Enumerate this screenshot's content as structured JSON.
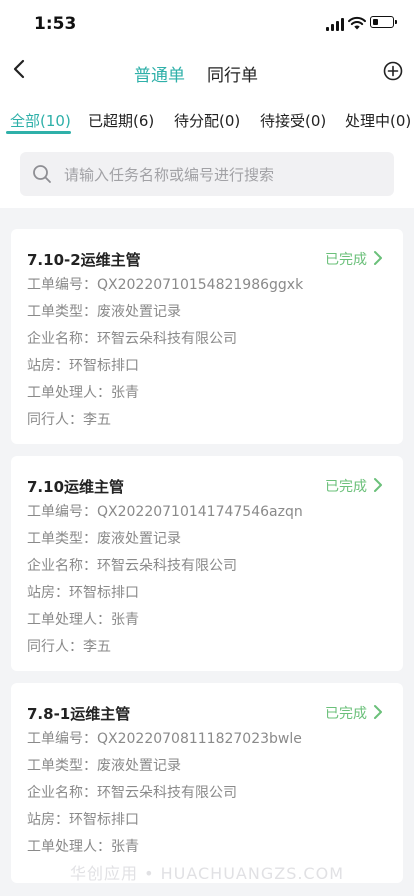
{
  "status_bar": {
    "time": "1:53"
  },
  "nav": {
    "segments": [
      "普通单",
      "同行单"
    ],
    "active": 0
  },
  "tabs": [
    {
      "label": "全部(10)",
      "active": true
    },
    {
      "label": "已超期(6)",
      "active": false
    },
    {
      "label": "待分配(0)",
      "active": false
    },
    {
      "label": "待接受(0)",
      "active": false
    },
    {
      "label": "处理中(0)",
      "active": false
    }
  ],
  "search": {
    "placeholder": "请输入任务名称或编号进行搜索",
    "value": ""
  },
  "cards": [
    {
      "title": "7.10-2运维主管",
      "status": "已完成",
      "rows": [
        {
          "label": "工单编号：",
          "value": "QX20220710154821986ggxk"
        },
        {
          "label": "工单类型：",
          "value": "废液处置记录"
        },
        {
          "label": "企业名称：",
          "value": "环智云朵科技有限公司"
        },
        {
          "label": "站房：",
          "value": "环智标排口"
        },
        {
          "label": "工单处理人：",
          "value": "张青"
        },
        {
          "label": "同行人：",
          "value": "李五"
        }
      ]
    },
    {
      "title": "7.10运维主管",
      "status": "已完成",
      "rows": [
        {
          "label": "工单编号：",
          "value": "QX20220710141747546azqn"
        },
        {
          "label": "工单类型：",
          "value": "废液处置记录"
        },
        {
          "label": "企业名称：",
          "value": "环智云朵科技有限公司"
        },
        {
          "label": "站房：",
          "value": "环智标排口"
        },
        {
          "label": "工单处理人：",
          "value": "张青"
        },
        {
          "label": "同行人：",
          "value": "李五"
        }
      ]
    },
    {
      "title": "7.8-1运维主管",
      "status": "已完成",
      "rows": [
        {
          "label": "工单编号：",
          "value": "QX20220708111827023bwle"
        },
        {
          "label": "工单类型：",
          "value": "废液处置记录"
        },
        {
          "label": "企业名称：",
          "value": "环智云朵科技有限公司"
        },
        {
          "label": "站房：",
          "value": "环智标排口"
        },
        {
          "label": "工单处理人：",
          "value": "张青"
        }
      ]
    }
  ],
  "watermark": "华创应用 • HUACHUANGZS.COM",
  "colors": {
    "accent": "#2fb0a9",
    "done": "#6bc07a",
    "muted": "#8a8a8a"
  }
}
